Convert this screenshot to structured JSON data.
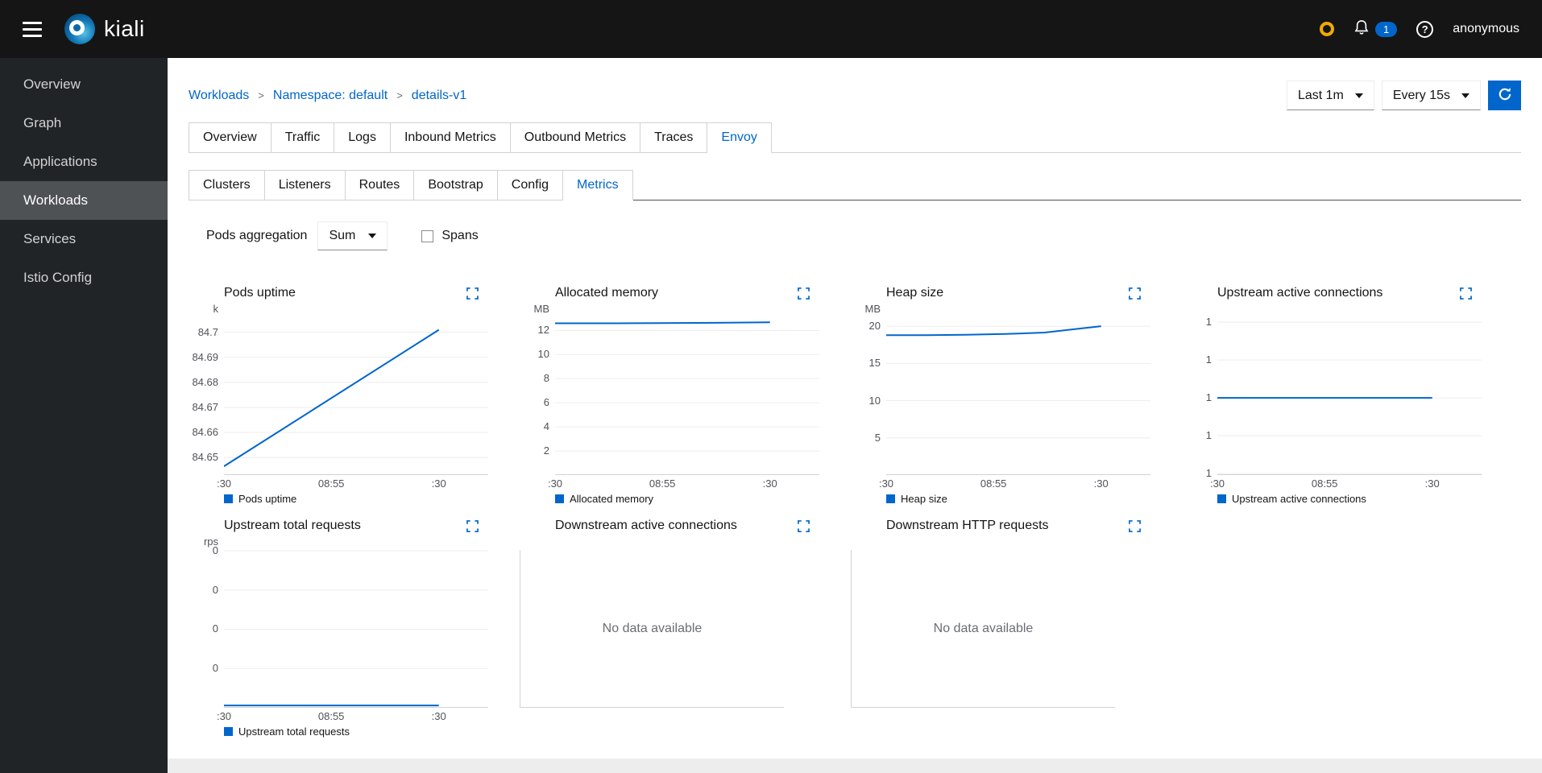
{
  "masthead": {
    "brand": "kiali",
    "user": "anonymous",
    "notification_count": "1"
  },
  "sidebar": {
    "items": [
      {
        "label": "Overview"
      },
      {
        "label": "Graph"
      },
      {
        "label": "Applications"
      },
      {
        "label": "Workloads"
      },
      {
        "label": "Services"
      },
      {
        "label": "Istio Config"
      }
    ],
    "active": "Workloads"
  },
  "breadcrumb": {
    "separator": ">",
    "items": [
      "Workloads",
      "Namespace: default",
      "details-v1"
    ]
  },
  "toolbar": {
    "duration": "Last 1m",
    "refresh_interval": "Every 15s"
  },
  "tabs": {
    "main": [
      "Overview",
      "Traffic",
      "Logs",
      "Inbound Metrics",
      "Outbound Metrics",
      "Traces",
      "Envoy"
    ],
    "main_active": "Envoy",
    "sub": [
      "Clusters",
      "Listeners",
      "Routes",
      "Bootstrap",
      "Config",
      "Metrics"
    ],
    "sub_active": "Metrics"
  },
  "controls": {
    "aggregation_label": "Pods aggregation",
    "aggregation_value": "Sum",
    "spans_label": "Spans",
    "spans_checked": false
  },
  "colors": {
    "accent": "#0066cc",
    "line": "#0066cc",
    "grid": "#ededed",
    "axis": "#d2d2d2",
    "masthead": "#151515",
    "sidebar": "#212427",
    "sidebar_active": "#4f5255",
    "warning": "#f0ab00",
    "tick_text": "#4f5258"
  },
  "chart_data": [
    {
      "type": "line",
      "title": "Pods uptime",
      "unit": "k",
      "legend": "Pods uptime",
      "ymin": 84.643,
      "ymax": 84.706,
      "yticks": [
        {
          "label": "84.7",
          "value": 84.7
        },
        {
          "label": "84.69",
          "value": 84.69
        },
        {
          "label": "84.68",
          "value": 84.68
        },
        {
          "label": "84.67",
          "value": 84.67
        },
        {
          "label": "84.66",
          "value": 84.66
        },
        {
          "label": "84.65",
          "value": 84.65
        }
      ],
      "xticks": [
        {
          "label": ":30",
          "pos": 0
        },
        {
          "label": "08:55",
          "pos": 0.406
        },
        {
          "label": ":30",
          "pos": 0.813
        }
      ],
      "series": {
        "x": [
          0,
          0.813
        ],
        "y": [
          84.6465,
          84.701
        ]
      }
    },
    {
      "type": "line",
      "title": "Allocated memory",
      "unit": "MB",
      "legend": "Allocated memory",
      "ymin": 0,
      "ymax": 13.1,
      "yticks": [
        {
          "label": "12",
          "value": 12
        },
        {
          "label": "10",
          "value": 10
        },
        {
          "label": "8",
          "value": 8
        },
        {
          "label": "6",
          "value": 6
        },
        {
          "label": "4",
          "value": 4
        },
        {
          "label": "2",
          "value": 2
        }
      ],
      "xticks": [
        {
          "label": ":30",
          "pos": 0
        },
        {
          "label": "08:55",
          "pos": 0.406
        },
        {
          "label": ":30",
          "pos": 0.813
        }
      ],
      "series": {
        "x": [
          0,
          0.2,
          0.4,
          0.6,
          0.813
        ],
        "y": [
          12.6,
          12.6,
          12.62,
          12.64,
          12.68
        ]
      }
    },
    {
      "type": "line",
      "title": "Heap size",
      "unit": "MB",
      "legend": "Heap size",
      "ymin": 0,
      "ymax": 21.2,
      "yticks": [
        {
          "label": "20",
          "value": 20
        },
        {
          "label": "15",
          "value": 15
        },
        {
          "label": "10",
          "value": 10
        },
        {
          "label": "5",
          "value": 5
        }
      ],
      "xticks": [
        {
          "label": ":30",
          "pos": 0
        },
        {
          "label": "08:55",
          "pos": 0.406
        },
        {
          "label": ":30",
          "pos": 0.813
        }
      ],
      "series": {
        "x": [
          0,
          0.15,
          0.3,
          0.45,
          0.6,
          0.7,
          0.813
        ],
        "y": [
          18.8,
          18.8,
          18.85,
          18.95,
          19.15,
          19.55,
          20.0
        ]
      }
    },
    {
      "type": "line",
      "title": "Upstream active connections",
      "unit": "",
      "legend": "Upstream active connections",
      "ymin": 0.9996,
      "ymax": 1.0413,
      "yticks": [
        {
          "label": "1",
          "value": 1.04
        },
        {
          "label": "1",
          "value": 1.03
        },
        {
          "label": "1",
          "value": 1.02
        },
        {
          "label": "1",
          "value": 1.01
        },
        {
          "label": "1",
          "value": 1.0
        }
      ],
      "xticks": [
        {
          "label": ":30",
          "pos": 0
        },
        {
          "label": "08:55",
          "pos": 0.406
        },
        {
          "label": ":30",
          "pos": 0.813
        }
      ],
      "series": {
        "x": [
          0,
          0.813
        ],
        "y": [
          1.02,
          1.02
        ]
      }
    },
    {
      "type": "line",
      "title": "Upstream total requests",
      "unit": "rps",
      "legend": "Upstream total requests",
      "ymin": 0,
      "ymax": 0.0402,
      "yticks": [
        {
          "label": "0",
          "value": 0.04
        },
        {
          "label": "0",
          "value": 0.03
        },
        {
          "label": "0",
          "value": 0.02
        },
        {
          "label": "0",
          "value": 0.01
        }
      ],
      "xticks": [
        {
          "label": ":30",
          "pos": 0
        },
        {
          "label": "08:55",
          "pos": 0.406
        },
        {
          "label": ":30",
          "pos": 0.813
        }
      ],
      "series": {
        "x": [
          0,
          0.813
        ],
        "y": [
          0.0006,
          0.0006
        ]
      }
    },
    {
      "type": "line",
      "title": "Downstream active connections",
      "no_data": true,
      "message": "No data available"
    },
    {
      "type": "line",
      "title": "Downstream HTTP requests",
      "no_data": true,
      "message": "No data available"
    }
  ]
}
